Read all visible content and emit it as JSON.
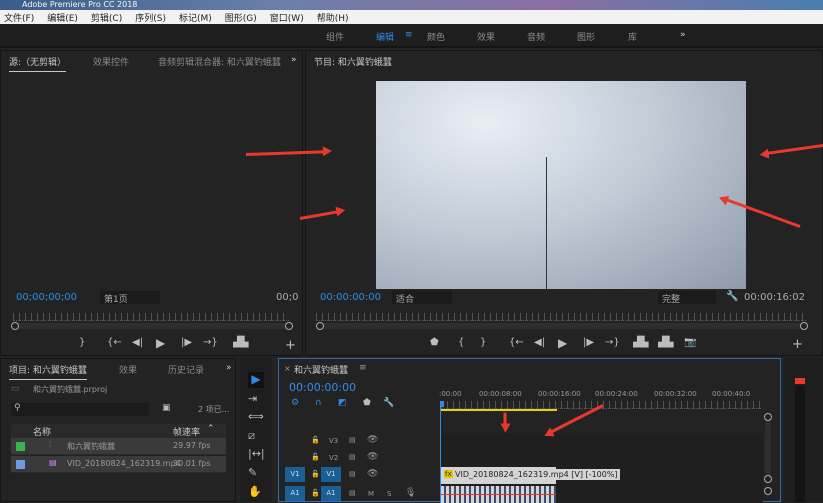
{
  "window": {
    "title": "Adobe Premiere Pro CC 2018"
  },
  "menu": [
    "文件(F)",
    "编辑(E)",
    "剪辑(C)",
    "序列(S)",
    "标记(M)",
    "图形(G)",
    "窗口(W)",
    "帮助(H)"
  ],
  "workspaces": {
    "items": [
      "组件",
      "编辑",
      "颜色",
      "效果",
      "音频",
      "图形",
      "库"
    ],
    "active": "编辑",
    "more": "»"
  },
  "source": {
    "tabs": [
      "源:（无剪辑）",
      "效果控件",
      "音频剪辑混合器: 和六翼钓蛾蠶"
    ],
    "more": "»",
    "timecode": "00;00;00;00",
    "page": "第1页",
    "end_timecode": "00;0"
  },
  "program": {
    "tab": "节目: 和六翼钓蛾蠶",
    "timecode": "00:00:00:00",
    "fit": "适合",
    "quality": "完整",
    "duration": "00:00:16:02"
  },
  "project": {
    "tabs": [
      "项目: 和六翼钓蛾蠶",
      "效果",
      "历史记录"
    ],
    "more": "»",
    "file": "和六翼钓蛾蠶.prproj",
    "search_placeholder": "",
    "count": "2 项已...",
    "col_name": "名称",
    "col_fps": "帧速率",
    "items": [
      {
        "name": "和六翼钓蛾蠶",
        "fps": "29.97 fps",
        "color": "#3cb44b"
      },
      {
        "name": "VID_20180824_162319.mp4",
        "fps": "30.01 fps",
        "color": "#6c9be0"
      }
    ]
  },
  "timeline": {
    "tab": "和六翼钓蛾蠶",
    "timecode": "00:00:00:00",
    "ruler": [
      ":00:00",
      "00:00:08:00",
      "00:00:16:00",
      "00:00:24:00",
      "00:00:32:00",
      "00:00:40:0"
    ],
    "tracks": [
      {
        "id": "V3"
      },
      {
        "id": "V2"
      },
      {
        "id": "V1",
        "target": "V1"
      },
      {
        "id": "A1",
        "target": "A1",
        "m": "M",
        "s": "S"
      }
    ],
    "video_clip": "VID_20180824_162319.mp4 [V] [-100%]",
    "fx": "fx"
  },
  "colors": {
    "accent": "#2d8ceb",
    "annotation": "#e8392e",
    "work_area": "#e6d400"
  }
}
